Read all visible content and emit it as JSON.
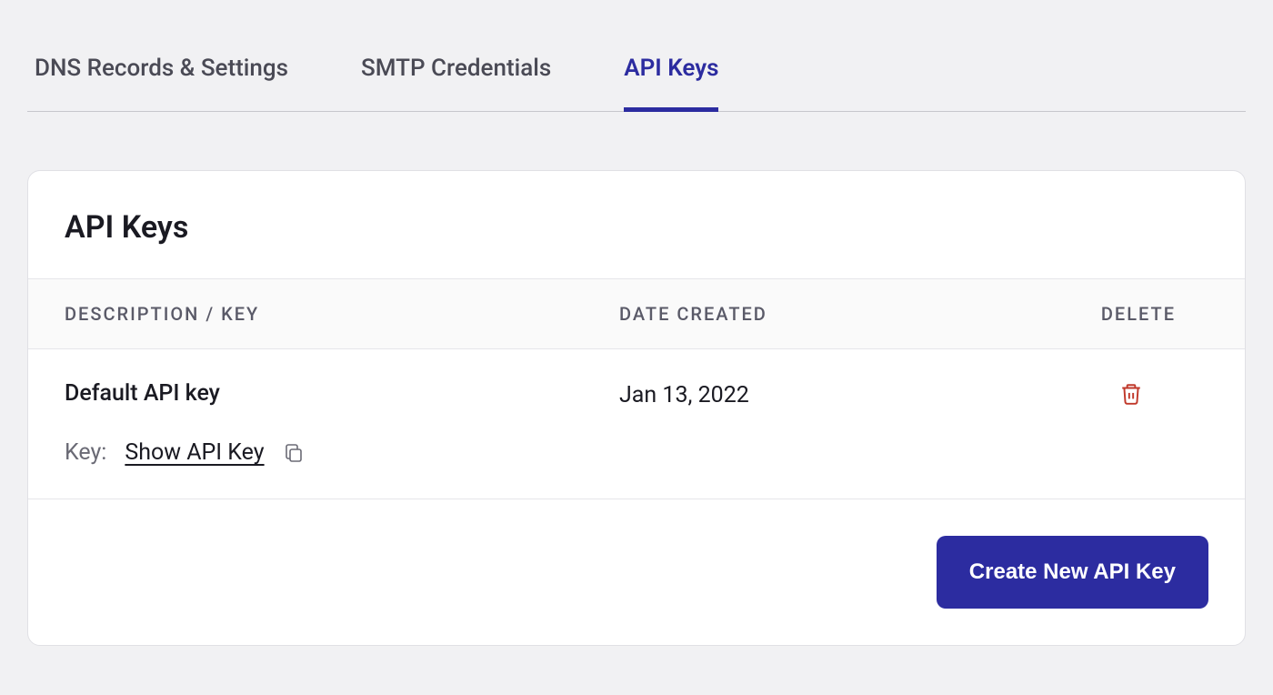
{
  "tabs": [
    {
      "label": "DNS Records & Settings",
      "active": false
    },
    {
      "label": "SMTP Credentials",
      "active": false
    },
    {
      "label": "API Keys",
      "active": true
    }
  ],
  "card": {
    "title": "API Keys",
    "columns": {
      "description": "DESCRIPTION / KEY",
      "date_created": "DATE CREATED",
      "delete": "DELETE"
    },
    "rows": [
      {
        "name": "Default API key",
        "date": "Jan 13, 2022",
        "key_label": "Key:",
        "show_label": "Show API Key"
      }
    ],
    "create_button": "Create New API Key"
  }
}
